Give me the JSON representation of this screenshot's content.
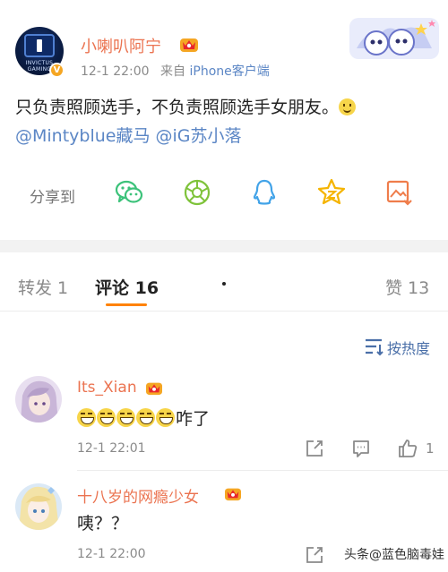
{
  "post": {
    "username": "小喇叭阿宁",
    "time": "12-1 22:00",
    "source_prefix": "来自",
    "source": "iPhone客户端",
    "text": "只负责照顾选手，不负责照顾选手女朋友。",
    "mentions": [
      "@Mintyblue藏马",
      "@iG苏小落"
    ],
    "avatar_text": "INVICTUS GAMING",
    "verified_mark": "V"
  },
  "share": {
    "label": "分享到",
    "icons": [
      "wechat-icon",
      "moments-icon",
      "qq-icon",
      "qzone-icon",
      "save-image-icon"
    ]
  },
  "tabs": {
    "repost": "转发 1",
    "comments": "评论 16",
    "likes": "赞 13"
  },
  "sort": {
    "label": "按热度"
  },
  "comments": [
    {
      "name": "Its_Xian",
      "text": "咋了",
      "emoji_count": 5,
      "time": "12-1 22:01",
      "like_count": "1"
    },
    {
      "name": "十八岁的网瘾少女",
      "text": "咦？？",
      "time": "12-1 22:00"
    }
  ],
  "watermark": "头条@蓝色脑毒娃",
  "colors": {
    "name_orange": "#eb7350",
    "link_blue": "#5b86c5",
    "accent_orange": "#ff8200"
  }
}
